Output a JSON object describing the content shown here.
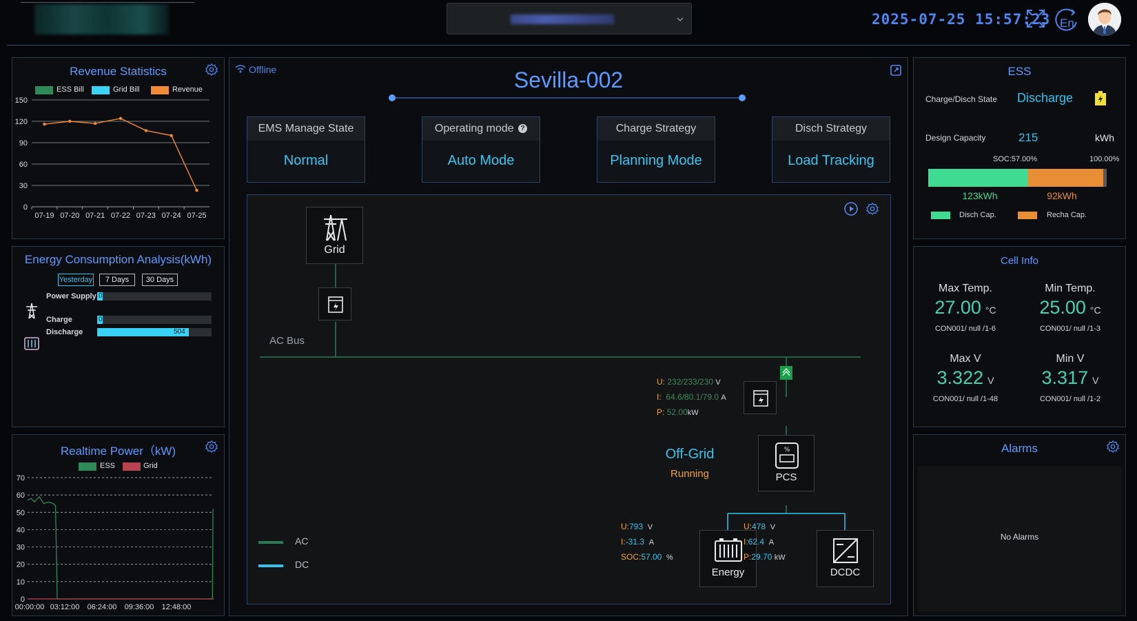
{
  "header": {
    "datetime": "2025-07-25  15:57:23",
    "lang_label": "En"
  },
  "revenue": {
    "title": "Revenue Statistics",
    "legend": [
      "ESS Bill",
      "Grid Bill",
      "Revenue"
    ],
    "legend_colors": [
      "#2e8b57",
      "#3bd3f5",
      "#f08a34"
    ],
    "chart_data": {
      "type": "line",
      "categories": [
        "07-19",
        "07-20",
        "07-21",
        "07-22",
        "07-23",
        "07-24",
        "07-25"
      ],
      "series": [
        {
          "name": "Revenue",
          "values": [
            116,
            120,
            117,
            124,
            107,
            100,
            23
          ]
        }
      ],
      "ylim": [
        0,
        150
      ],
      "yticks": [
        0,
        30,
        60,
        90,
        120,
        150
      ],
      "xlabel": "",
      "ylabel": ""
    }
  },
  "energy": {
    "title": "Energy Consumption Analysis(kWh)",
    "tabs": [
      "Yesterday",
      "7 Days",
      "30 Days"
    ],
    "active_tab": "Yesterday",
    "rows": [
      {
        "label": "Power Supply",
        "value": "0",
        "fraction": 0.0
      },
      {
        "label": "Charge",
        "value": "0",
        "fraction": 0.0
      },
      {
        "label": "Discharge",
        "value": "504",
        "fraction": 0.8
      }
    ]
  },
  "realtime": {
    "title": "Realtime Power（kW)",
    "legend": [
      "ESS",
      "Grid"
    ],
    "legend_colors": [
      "#2e8b57",
      "#b8434e"
    ],
    "chart_data": {
      "type": "line",
      "x_ticks": [
        "00:00:00",
        "03:12:00",
        "06:24:00",
        "09:36:00",
        "12:48:00"
      ],
      "ylim": [
        0,
        70
      ],
      "yticks": [
        0,
        10,
        20,
        30,
        40,
        50,
        60,
        70
      ],
      "series": [
        {
          "name": "ESS",
          "points": [
            [
              0,
              57
            ],
            [
              0.3,
              58
            ],
            [
              0.6,
              56
            ],
            [
              1.0,
              59
            ],
            [
              1.4,
              55
            ],
            [
              1.8,
              56
            ],
            [
              2.2,
              55
            ],
            [
              2.4,
              54
            ],
            [
              2.5,
              20
            ],
            [
              2.55,
              0
            ],
            [
              5.0,
              0
            ],
            [
              10.0,
              0
            ],
            [
              15.0,
              0
            ],
            [
              15.9,
              0
            ],
            [
              15.95,
              52
            ]
          ]
        },
        {
          "name": "Grid",
          "points": [
            [
              0,
              0
            ],
            [
              15.95,
              0
            ]
          ]
        }
      ],
      "xlabel": "",
      "ylabel": ""
    }
  },
  "center": {
    "status": "Offline",
    "site_name": "Sevilla-002",
    "cards": [
      {
        "head": "EMS Manage State",
        "value": "Normal"
      },
      {
        "head": "Operating mode",
        "value": "Auto Mode"
      },
      {
        "head": "Charge Strategy",
        "value": "Planning Mode"
      },
      {
        "head": "Disch Strategy",
        "value": "Load Tracking"
      }
    ],
    "diagram": {
      "grid_label": "Grid",
      "ac_bus_label": "AC Bus",
      "pcs_label": "PCS",
      "energy_label": "Energy",
      "dcdc_label": "DCDC",
      "mode": "Off-Grid",
      "run_state": "Running",
      "meter": {
        "u_label": "U:",
        "u_value": "232/233/230",
        "u_unit": "V",
        "i_label": "I:",
        "i_value": "64.6/80.1/79.0",
        "i_unit": "A",
        "p_label": "P:",
        "p_value": "52.00",
        "p_unit": "kW"
      },
      "battery": {
        "u_label": "U:",
        "u_value": "793",
        "u_unit": "V",
        "i_label": "I:",
        "i_value": "-31.3",
        "i_unit": "A",
        "soc_label": "SOC:",
        "soc_value": "57.00",
        "soc_unit": "%"
      },
      "dcdc": {
        "u_label": "U:",
        "u_value": "478",
        "u_unit": "V",
        "i_label": "I:",
        "i_value": "62.4",
        "i_unit": "A",
        "p_label": "P:",
        "p_value": "29.70",
        "p_unit": "kW"
      },
      "legend_ac": "AC",
      "legend_dc": "DC",
      "ac_color": "#2a7a55",
      "dc_color": "#35c3ee"
    }
  },
  "ess": {
    "title": "ESS",
    "state_label": "Charge/Disch State",
    "state_value": "Discharge",
    "capacity_label": "Design Capacity",
    "capacity_value": "215",
    "capacity_unit": "kWh",
    "soc_label": "SOC:57.00%",
    "max_label": "100.00%",
    "soc_fraction": 0.57,
    "disch_value": "123kWh",
    "recha_value": "92kWh",
    "legend_disch": "Disch Cap.",
    "legend_recha": "Recha Cap."
  },
  "cell": {
    "title": "Cell Info",
    "items": [
      {
        "label": "Max Temp.",
        "value": "27.00",
        "unit": "°C",
        "sub": "CON001/ null /1-6"
      },
      {
        "label": "Min Temp.",
        "value": "25.00",
        "unit": "°C",
        "sub": "CON001/ null /1-3"
      },
      {
        "label": "Max V",
        "value": "3.322",
        "unit": "V",
        "sub": "CON001/ null /1-48"
      },
      {
        "label": "Min V",
        "value": "3.317",
        "unit": "V",
        "sub": "CON001/ null /1-2"
      }
    ]
  },
  "alarms": {
    "title": "Alarms",
    "empty_text": "No Alarms"
  }
}
